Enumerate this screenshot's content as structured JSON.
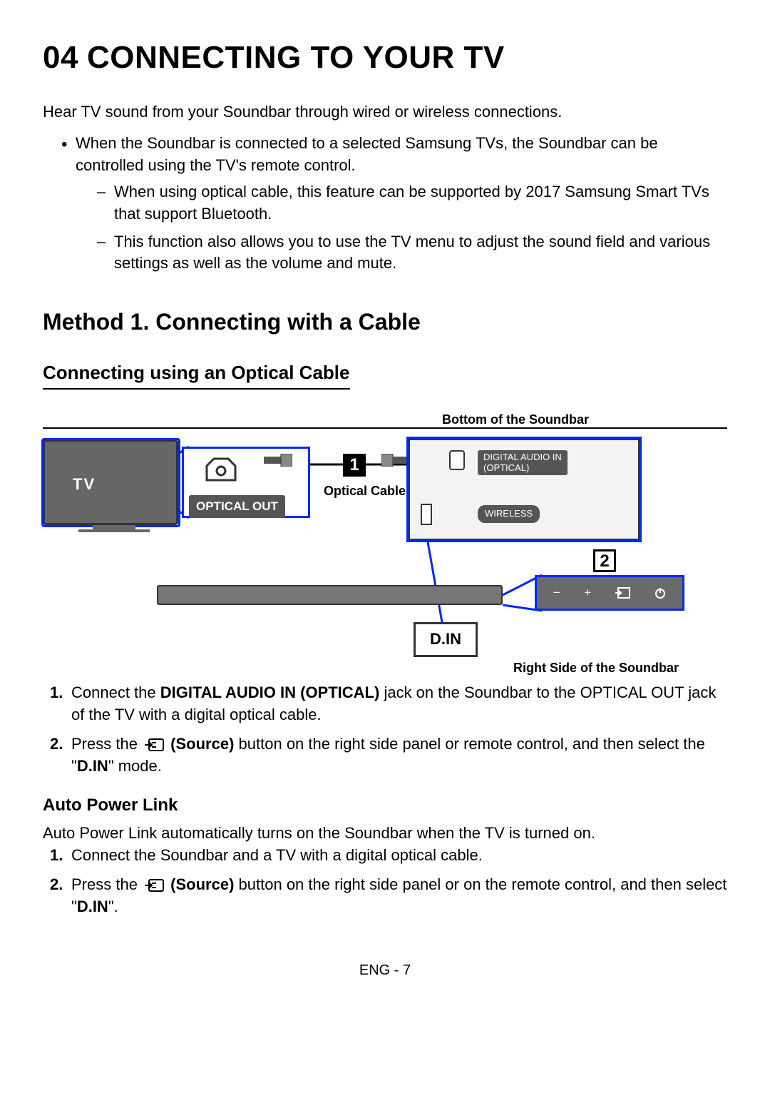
{
  "section_number": "04",
  "section_title": "CONNECTING TO YOUR TV",
  "intro": "Hear TV sound from your Soundbar through wired or wireless connections.",
  "bullets": [
    {
      "text": "When the Soundbar is connected to a selected Samsung TVs, the Soundbar can be controlled using the TV's remote control.",
      "subs": [
        "When using optical cable, this feature can be supported by 2017 Samsung Smart TVs that support Bluetooth.",
        "This function also allows you to use the TV menu to adjust the sound field and various settings as well as the volume and mute."
      ]
    }
  ],
  "method_title": "Method 1. Connecting with a Cable",
  "sub_title": "Connecting using an Optical Cable",
  "diagram": {
    "top_caption": "Bottom of the Soundbar",
    "tv_label": "TV",
    "optical_out": "OPTICAL OUT",
    "cable_label": "Optical Cable",
    "badge1": "1",
    "port_label1_line1": "DIGITAL AUDIO IN",
    "port_label1_line2": "(OPTICAL)",
    "port_label2": "WIRELESS",
    "badge2": "2",
    "din": "D.IN",
    "bottom_caption": "Right Side of the Soundbar"
  },
  "steps": [
    {
      "num": "1.",
      "pre": "Connect the ",
      "bold1": "DIGITAL AUDIO IN (OPTICAL)",
      "post": " jack on the Soundbar to the OPTICAL OUT jack of the TV with a digital optical cable."
    },
    {
      "num": "2.",
      "pre": "Press the ",
      "icon": true,
      "bold_src": "(Source)",
      "post1": " button on the right side panel or remote control, and then select the \"",
      "bold2": "D.IN",
      "post2": "\" mode."
    }
  ],
  "apl_title": "Auto Power Link",
  "apl_intro": "Auto Power Link automatically turns on the Soundbar when the TV is turned on.",
  "apl_steps": [
    {
      "num": "1.",
      "text": "Connect the Soundbar and a TV with a digital optical cable."
    },
    {
      "num": "2.",
      "pre": "Press the ",
      "icon": true,
      "bold_src": "(Source)",
      "post1": " button on the right side panel or on the remote control, and then select \"",
      "bold2": "D.IN",
      "post2": "\"."
    }
  ],
  "page_num": "ENG - 7"
}
